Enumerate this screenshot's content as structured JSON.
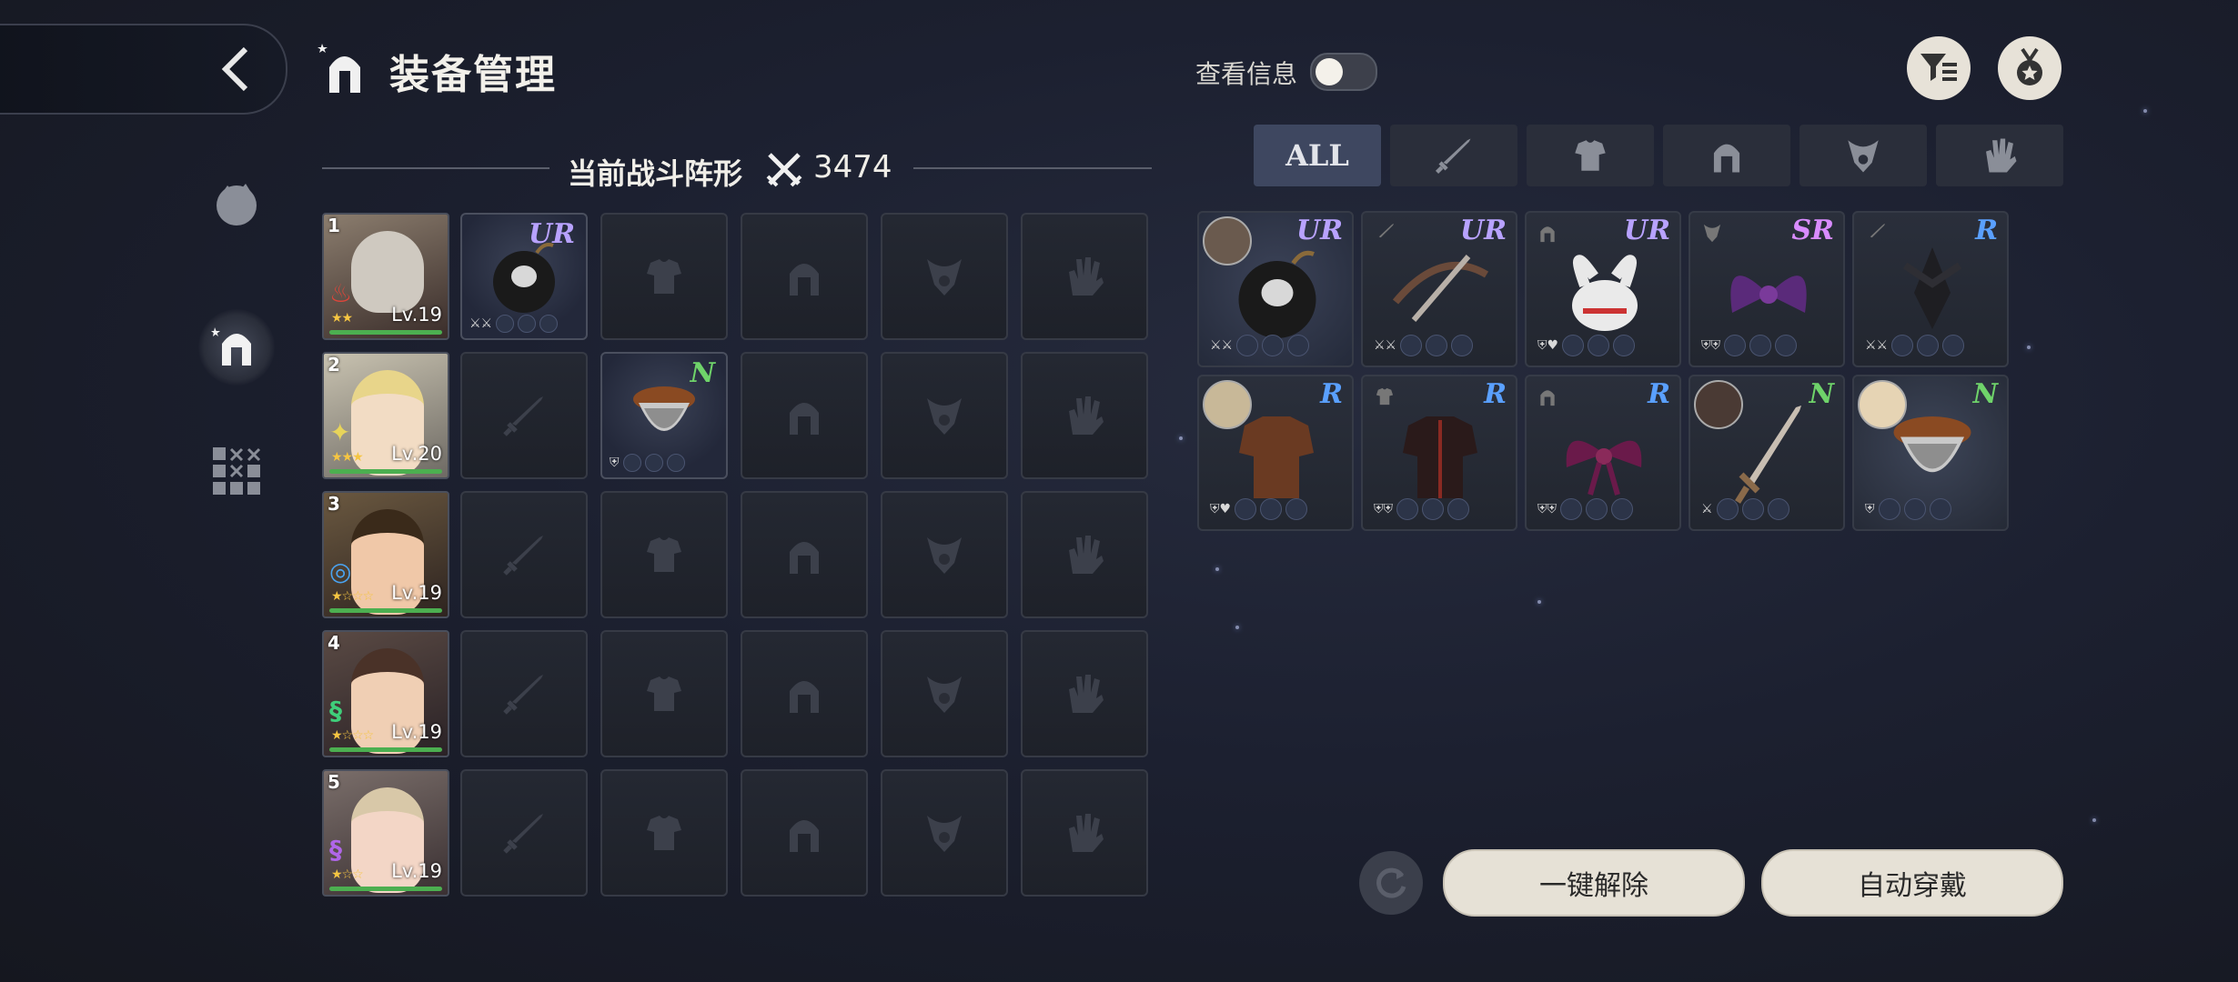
{
  "header": {
    "title": "装备管理",
    "view_info_label": "查看信息",
    "view_info_on": false
  },
  "formation": {
    "label": "当前战斗阵形",
    "power": "3474"
  },
  "team": [
    {
      "index": "1",
      "level": "Lv.19",
      "stars": "★★",
      "element_color": "#e0453a"
    },
    {
      "index": "2",
      "level": "Lv.20",
      "stars": "★★★",
      "element_color": "#e8d45a"
    },
    {
      "index": "3",
      "level": "Lv.19",
      "stars": "★☆☆☆",
      "element_color": "#4aa3f0"
    },
    {
      "index": "4",
      "level": "Lv.19",
      "stars": "★☆☆☆",
      "element_color": "#3fcf7a"
    },
    {
      "index": "5",
      "level": "Lv.19",
      "stars": "★☆☆",
      "element_color": "#b066e8"
    }
  ],
  "equipped": {
    "row1_weapon_rank": "UR",
    "row2_armor_rank": "N"
  },
  "tabs": {
    "all_label": "ALL"
  },
  "inventory": [
    {
      "rank": "UR",
      "kind": "bomb",
      "rank_color": "#b8a2ff"
    },
    {
      "rank": "UR",
      "kind": "crossbow",
      "rank_color": "#b8a2ff"
    },
    {
      "rank": "UR",
      "kind": "bunny-helm",
      "rank_color": "#b8a2ff"
    },
    {
      "rank": "SR",
      "kind": "wings",
      "rank_color": "#d98cff"
    },
    {
      "rank": "R",
      "kind": "dark-blade",
      "rank_color": "#5aa0ff"
    },
    {
      "rank": "R",
      "kind": "leather-armor",
      "rank_color": "#5aa0ff"
    },
    {
      "rank": "R",
      "kind": "red-coat",
      "rank_color": "#5aa0ff"
    },
    {
      "rank": "R",
      "kind": "ribbon",
      "rank_color": "#5aa0ff"
    },
    {
      "rank": "N",
      "kind": "sword",
      "rank_color": "#6fd36a"
    },
    {
      "rank": "N",
      "kind": "fur-armor",
      "rank_color": "#6fd36a"
    }
  ],
  "buttons": {
    "unequip_all": "一键解除",
    "auto_equip": "自动穿戴"
  }
}
